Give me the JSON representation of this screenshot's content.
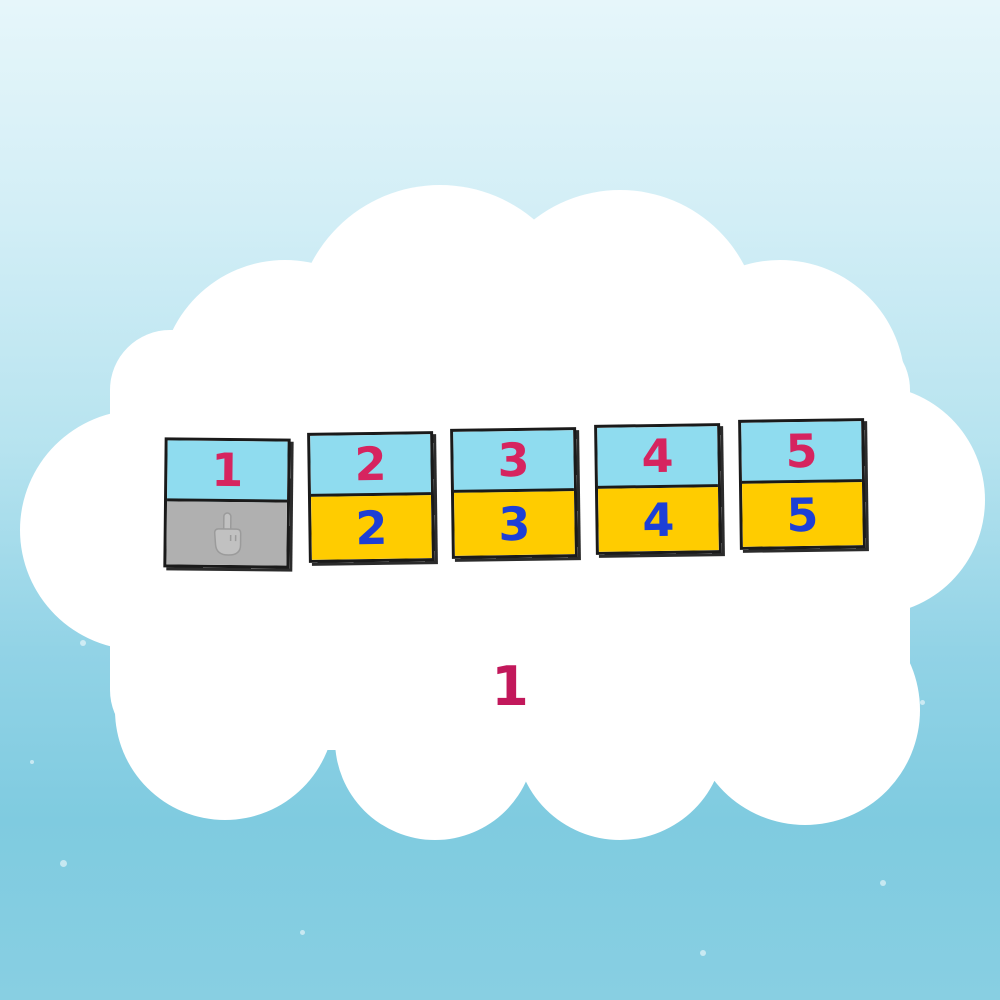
{
  "puzzle": {
    "cards": [
      {
        "top": "1",
        "bottom": "",
        "bottom_state": "empty"
      },
      {
        "top": "2",
        "bottom": "2",
        "bottom_state": "filled"
      },
      {
        "top": "3",
        "bottom": "3",
        "bottom_state": "filled"
      },
      {
        "top": "4",
        "bottom": "4",
        "bottom_state": "filled"
      },
      {
        "top": "5",
        "bottom": "5",
        "bottom_state": "filled"
      }
    ],
    "hint_icon": "pointing-finger-icon",
    "answer": "1"
  },
  "colors": {
    "top_number": "#d6245f",
    "bottom_number": "#1d3fd6",
    "card_top_bg": "#8fdcef",
    "card_bottom_bg": "#ffcc00",
    "empty_slot_bg": "#b0b0b0"
  }
}
